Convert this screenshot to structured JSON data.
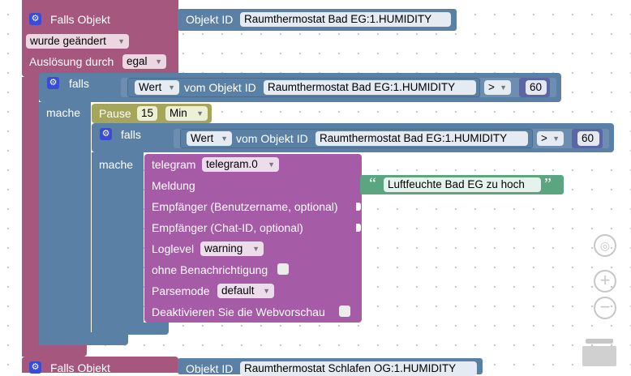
{
  "trigger1": {
    "title": "Falls Objekt",
    "objid_label": "Objekt ID",
    "objid_value": "Raumthermostat Bad EG:1.HUMIDITY",
    "changed": "wurde geändert",
    "trigger_by_label": "Auslösung durch",
    "trigger_by_value": "egal"
  },
  "if1": {
    "falls": "falls",
    "mache": "mache",
    "wert": "Wert",
    "vom_objekt": "vom Objekt ID",
    "objid": "Raumthermostat Bad EG:1.HUMIDITY",
    "op": ">",
    "value": "60"
  },
  "pause": {
    "label": "Pause",
    "amount": "15",
    "unit": "Min"
  },
  "if2": {
    "falls": "falls",
    "mache": "mache",
    "wert": "Wert",
    "vom_objekt": "vom Objekt ID",
    "objid": "Raumthermostat Bad EG:1.HUMIDITY",
    "op": ">",
    "value": "60"
  },
  "telegram": {
    "label": "telegram",
    "instance": "telegram.0",
    "meldung": "Meldung",
    "message": "Luftfeuchte Bad EG zu hoch",
    "quote_open": "“",
    "quote_close": "”",
    "recipient_user": "Empfänger (Benutzername, optional)",
    "recipient_chat": "Empfänger (Chat-ID, optional)",
    "loglevel_label": "Loglevel",
    "loglevel_value": "warning",
    "silent_label": "ohne Benachrichtigung",
    "parsemode_label": "Parsemode",
    "parsemode_value": "default",
    "disable_preview_label": "Deaktivieren Sie die Webvorschau"
  },
  "trigger2": {
    "title": "Falls Objekt",
    "objid_label": "Objekt ID",
    "objid_value": "Raumthermostat Schlafen OG:1.HUMIDITY"
  },
  "icons": {
    "gear": "gear-icon",
    "dropdown": "chevron-down-icon",
    "locate": "locate-icon",
    "zoom_in": "zoom-in-icon",
    "zoom_out": "zoom-out-icon",
    "trash": "trash-icon"
  },
  "colors": {
    "trigger": "#a5577d",
    "logic": "#5b80a5",
    "timer": "#a5a55b",
    "telegram": "#a55ba5",
    "text": "#5ba580"
  }
}
